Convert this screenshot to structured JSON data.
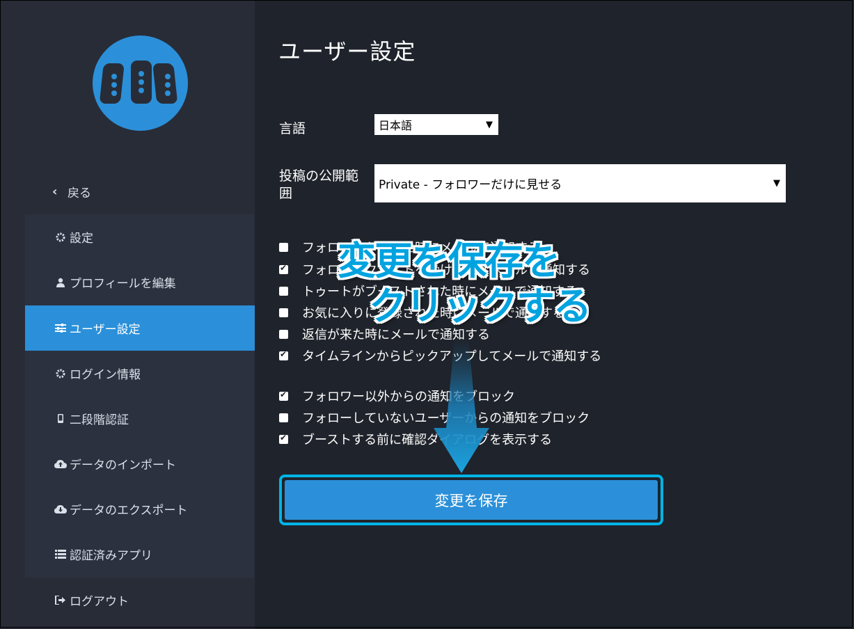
{
  "sidebar": {
    "back_label": "戻る",
    "items": [
      {
        "label": "設定",
        "icon": "gear-icon",
        "active": false
      },
      {
        "label": "プロフィールを編集",
        "icon": "user-icon",
        "active": false
      },
      {
        "label": "ユーザー設定",
        "icon": "sliders-icon",
        "active": true
      },
      {
        "label": "ログイン情報",
        "icon": "gear-icon",
        "active": false
      },
      {
        "label": "二段階認証",
        "icon": "mobile-icon",
        "active": false
      },
      {
        "label": "データのインポート",
        "icon": "cloud-upload-icon",
        "active": false
      },
      {
        "label": "データのエクスポート",
        "icon": "cloud-download-icon",
        "active": false
      },
      {
        "label": "認証済みアプリ",
        "icon": "list-icon",
        "active": false
      }
    ],
    "logout_label": "ログアウト"
  },
  "main": {
    "title": "ユーザー設定",
    "language": {
      "label": "言語",
      "value": "日本語"
    },
    "privacy": {
      "label_line1": "投稿の公開範",
      "label_line2": "囲",
      "value": "Private - フォロワーだけに見せる"
    },
    "notifications": [
      {
        "label": "フォロワーが増えた時にメールで通知する",
        "checked": false
      },
      {
        "label": "フォローリクエストを受けた時にメールで通知する",
        "checked": true
      },
      {
        "label": "トゥートがブーストされた時にメールで通知する",
        "checked": false
      },
      {
        "label": "お気に入りに登録された時にメールで通知する",
        "checked": false
      },
      {
        "label": "返信が来た時にメールで通知する",
        "checked": false
      },
      {
        "label": "タイムラインからピックアップしてメールで通知する",
        "checked": true
      }
    ],
    "other": [
      {
        "label": "フォロワー以外からの通知をブロック",
        "checked": true
      },
      {
        "label": "フォローしていないユーザーからの通知をブロック",
        "checked": false
      },
      {
        "label": "ブーストする前に確認ダイアログを表示する",
        "checked": true
      }
    ],
    "save_label": "変更を保存"
  },
  "annotation": {
    "line1": "変更を保存を",
    "line2": "クリックする"
  },
  "colors": {
    "accent": "#2b90d9",
    "highlight": "#00b4e6",
    "bg": "#1f232b",
    "sidebar": "#282c37"
  }
}
